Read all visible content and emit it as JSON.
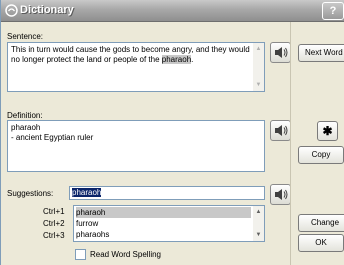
{
  "window": {
    "title": "Dictionary",
    "help_label": "?"
  },
  "sentence": {
    "label": "Sentence:",
    "text_before": "This in turn would cause the gods to become angry, and they would no longer protect the land or people of the ",
    "highlight": "pharaoh",
    "text_after": "."
  },
  "definition": {
    "label": "Definition:",
    "lines": [
      "pharaoh",
      "- ancient Egyptian ruler"
    ]
  },
  "suggestions": {
    "label": "Suggestions:",
    "value": "pharaoh",
    "items": [
      {
        "hotkey": "Ctrl+1",
        "word": "pharaoh"
      },
      {
        "hotkey": "Ctrl+2",
        "word": "furrow"
      },
      {
        "hotkey": "Ctrl+3",
        "word": "pharaohs"
      }
    ]
  },
  "read_spelling_label": "Read Word Spelling",
  "buttons": {
    "next": "Next Word",
    "star_glyph": "✱",
    "copy": "Copy",
    "change": "Change",
    "ok": "OK"
  },
  "icons": {
    "speaker": "speaker-icon",
    "title": "dictionary-app-icon"
  }
}
